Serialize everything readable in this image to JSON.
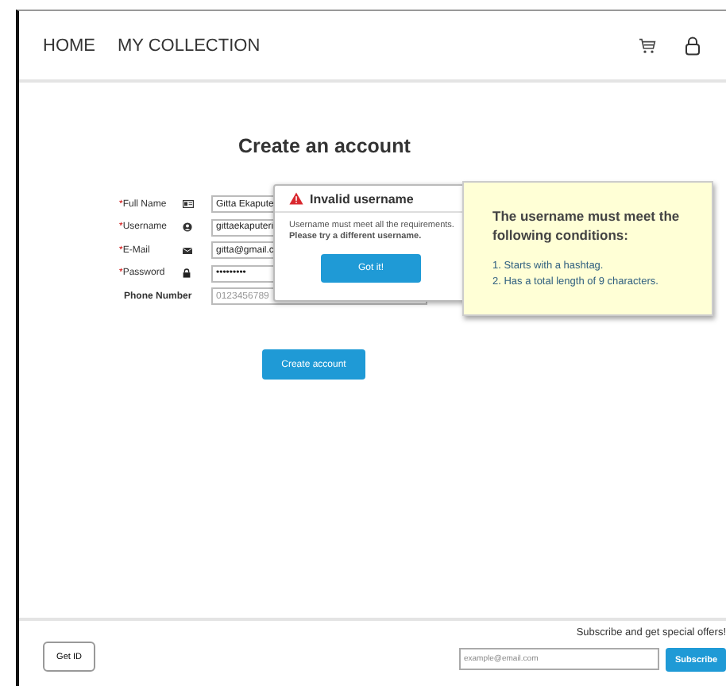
{
  "nav": {
    "links": [
      "HOME",
      "MY COLLECTION"
    ]
  },
  "form": {
    "title": "Create an account",
    "fields": [
      {
        "kind": "name",
        "mark": "*",
        "label": "Full Name",
        "value": "Gitta Ekapute"
      },
      {
        "kind": "username",
        "mark": "*",
        "label": "Username",
        "value": "gittaekaputeri"
      },
      {
        "kind": "email",
        "mark": "*",
        "label": "E-Mail",
        "value": "gitta@gmail.c"
      },
      {
        "kind": "password",
        "mark": "*",
        "label": "Password",
        "value": "•••••••••"
      },
      {
        "kind": "phone",
        "label": "Phone Number",
        "placeholder": "0123456789"
      }
    ],
    "submit": "Create account"
  },
  "dialog": {
    "title": "Invalid username",
    "message": "Username must meet all the requirements.",
    "hint": "Please try a different username.",
    "button": "Got it!"
  },
  "note": {
    "heading": "The username must meet the following conditions:",
    "conditions": [
      "1. Starts with a hashtag.",
      "2. Has a total length of 9 characters."
    ]
  },
  "footer": {
    "get_id": "Get ID",
    "subscribe_text": "Subscribe and get special offers!",
    "email_placeholder": "example@email.com",
    "subscribe_button": "Subscribe"
  }
}
